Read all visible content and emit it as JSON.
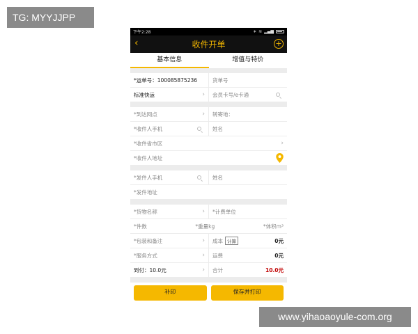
{
  "watermarks": {
    "top_left": "TG: MYYJJPP",
    "bottom_right": "www.yihaoaoyule-com.org"
  },
  "status_bar": {
    "time": "下午2:28"
  },
  "header": {
    "title": "收件开单"
  },
  "tabs": [
    {
      "label": "基本信息",
      "active": true
    },
    {
      "label": "增值与特价",
      "active": false
    }
  ],
  "form": {
    "waybill_label": "*运单号：100085875236",
    "cargo_no": "货单号",
    "service_type": "标准快运",
    "member_card_placeholder": "会员卡号/e卡通",
    "arrival_point": "*到达网点",
    "transfer": "转寄地：",
    "receiver_phone": "*收件人手机",
    "receiver_name": "姓名",
    "receiver_region": "*收件省市区",
    "receiver_address": "*收件人地址",
    "sender_phone": "*发件人手机",
    "sender_name": "姓名",
    "sender_address": "*发件地址",
    "goods_name": "*货物名称",
    "billing_unit": "*计费单位",
    "pieces": "*件数",
    "weight": "*重量kg",
    "volume": "*体积m³",
    "packaging": "*包装和备注",
    "cost_label": "成本",
    "calc_label": "计算",
    "cost_value": "0元",
    "service_mode": "*服务方式",
    "freight_label": "运费",
    "freight_value": "0元",
    "cod_label": "到付：10.0元",
    "total_label": "合计",
    "total_value": "10.0元"
  },
  "buttons": {
    "reprint": "补印",
    "save_print": "保存并打印"
  },
  "colors": {
    "accent": "#f5b800",
    "header_bg": "#111111",
    "total": "#c00000"
  }
}
